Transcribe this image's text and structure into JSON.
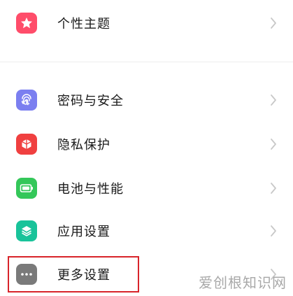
{
  "settings": {
    "items": [
      {
        "label": "个性主题",
        "icon": "theme-icon",
        "color": "#ff4d6a"
      },
      {
        "label": "密码与安全",
        "icon": "fingerprint-icon",
        "color": "#7b7ff0"
      },
      {
        "label": "隐私保护",
        "icon": "privacy-icon",
        "color": "#f04040"
      },
      {
        "label": "电池与性能",
        "icon": "battery-icon",
        "color": "#34c759"
      },
      {
        "label": "应用设置",
        "icon": "app-layers-icon",
        "color": "#19c39a"
      },
      {
        "label": "更多设置",
        "icon": "more-dots-icon",
        "color": "#7a7a7a"
      }
    ]
  },
  "watermark": {
    "text": "爱创根知识网"
  },
  "colors": {
    "highlight": "#d8242a",
    "chevron": "#c8c8c8"
  }
}
